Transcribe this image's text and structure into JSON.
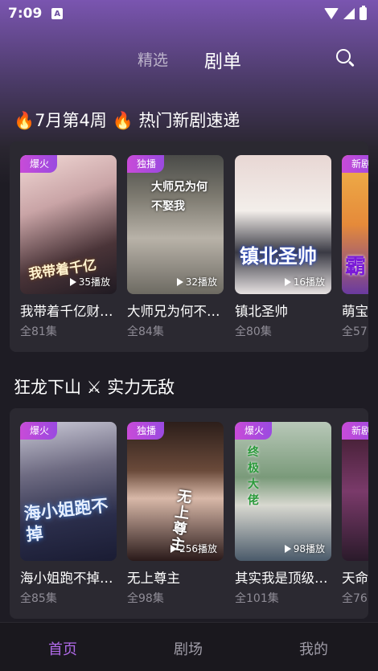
{
  "status": {
    "time": "7:09",
    "notification_icon": "A"
  },
  "top_nav": {
    "tabs": [
      {
        "label": "精选",
        "active": false
      },
      {
        "label": "剧单",
        "active": true
      }
    ]
  },
  "sections": [
    {
      "title": "🔥7月第4周 🔥 热门新剧速递",
      "dramas": [
        {
          "badge": "爆火",
          "plays": "35播放",
          "title": "我带着千亿财…",
          "episodes": "全81集",
          "poster_text": "我带着千亿"
        },
        {
          "badge": "独播",
          "plays": "32播放",
          "title": "大师兄为何不…",
          "episodes": "全84集",
          "poster_text": "大师兄为何不娶我"
        },
        {
          "badge": "",
          "plays": "16播放",
          "title": "镇北圣帅",
          "episodes": "全80集",
          "poster_text": "镇北圣帅"
        },
        {
          "badge": "新剧",
          "plays": "",
          "title": "萌宝",
          "episodes": "全57",
          "poster_text": "霸"
        }
      ]
    },
    {
      "title": "狂龙下山 ⚔ 实力无敌",
      "dramas": [
        {
          "badge": "爆火",
          "plays": "",
          "title": "海小姐跑不掉…",
          "episodes": "全85集",
          "poster_text": "海小姐跑不掉"
        },
        {
          "badge": "独播",
          "plays": "256播放",
          "title": "无上尊主",
          "episodes": "全98集",
          "poster_text": "无上尊主"
        },
        {
          "badge": "爆火",
          "plays": "98播放",
          "title": "其实我是顶级…",
          "episodes": "全101集",
          "poster_text": "终极大佬"
        },
        {
          "badge": "新剧",
          "plays": "",
          "title": "天命",
          "episodes": "全76",
          "poster_text": ""
        }
      ]
    }
  ],
  "bottom_nav": {
    "items": [
      {
        "label": "首页",
        "active": true
      },
      {
        "label": "剧场",
        "active": false
      },
      {
        "label": "我的",
        "active": false
      }
    ]
  },
  "colors": {
    "accent": "#b06ae8",
    "badge": "#c84bd8",
    "background": "#1e1c24",
    "panel": "#2b2931"
  },
  "icons": [
    "search-icon",
    "play-icon",
    "wifi-icon",
    "signal-icon",
    "battery-icon",
    "flame-icon"
  ]
}
